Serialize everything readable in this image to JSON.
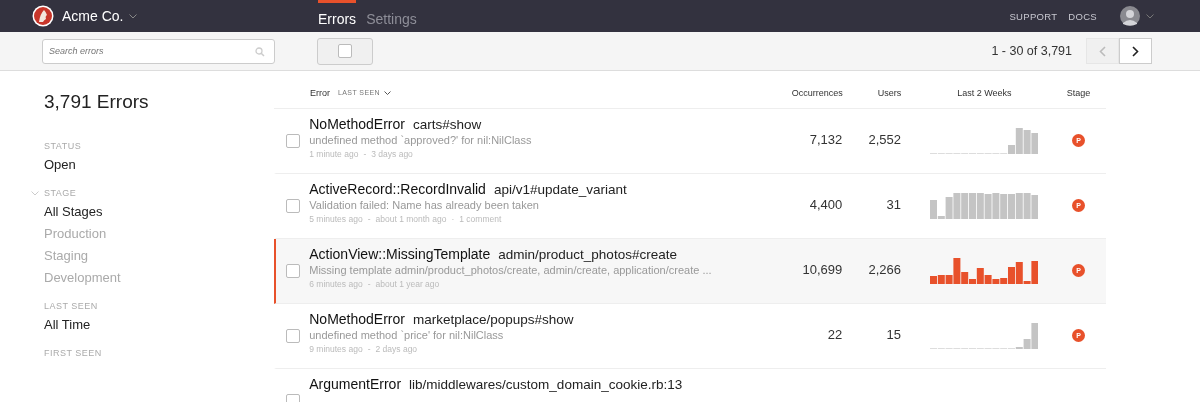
{
  "header": {
    "brand": "Acme Co.",
    "nav": [
      {
        "label": "Errors",
        "selected": true
      },
      {
        "label": "Settings",
        "selected": false
      }
    ],
    "links": [
      "SUPPORT",
      "DOCS"
    ]
  },
  "toolbar": {
    "search": {
      "placeholder": "Search errors"
    },
    "select_all": {
      "checked": false
    },
    "pagination": {
      "range": "1 - 30 of 3,791",
      "prev_disabled": true,
      "next_disabled": false
    }
  },
  "sidebar": {
    "title": "3,791 Errors",
    "sections": [
      {
        "label": "STATUS",
        "collapsible": false,
        "items": [
          {
            "label": "Open",
            "selected": true
          }
        ]
      },
      {
        "label": "STAGE",
        "collapsible": true,
        "items": [
          {
            "label": "All Stages",
            "selected": true
          },
          {
            "label": "Production",
            "selected": false
          },
          {
            "label": "Staging",
            "selected": false
          },
          {
            "label": "Development",
            "selected": false
          }
        ]
      },
      {
        "label": "LAST SEEN",
        "collapsible": false,
        "items": [
          {
            "label": "All Time",
            "selected": true
          }
        ]
      },
      {
        "label": "FIRST SEEN",
        "collapsible": false
      }
    ]
  },
  "table": {
    "columns": {
      "error": "Error",
      "sort": "LAST SEEN",
      "occurrences": "Occurrences",
      "users": "Users",
      "trend": "Last 2 Weeks",
      "stage": "Stage"
    },
    "rows": [
      {
        "checked": false,
        "highlighted": false,
        "error": "NoMethodError",
        "location": "carts#show",
        "message": "undefined method `approved?' for nil:NilClass",
        "meta": [
          "1 minute ago",
          "-",
          "3 days ago"
        ],
        "occurrences": "7,132",
        "users": "2,552",
        "stage": "P"
      },
      {
        "checked": false,
        "highlighted": false,
        "error": "ActiveRecord::RecordInvalid",
        "location": "api/v1#update_variant",
        "message": "Validation failed: Name has already been taken",
        "meta": [
          "5 minutes ago",
          "-",
          "about 1 month ago",
          "·",
          "1 comment"
        ],
        "occurrences": "4,400",
        "users": "31",
        "stage": "P"
      },
      {
        "checked": false,
        "highlighted": true,
        "error": "ActionView::MissingTemplate",
        "location": "admin/product_photos#create",
        "message": "Missing template admin/product_photos/create, admin/create, application/create ...",
        "meta": [
          "6 minutes ago",
          "-",
          "about 1 year ago"
        ],
        "occurrences": "10,699",
        "users": "2,266",
        "stage": "P"
      },
      {
        "checked": false,
        "highlighted": false,
        "error": "NoMethodError",
        "location": "marketplace/popups#show",
        "message": "undefined method `price' for nil:NilClass",
        "meta": [
          "9 minutes ago",
          "-",
          "2 days ago"
        ],
        "occurrences": "22",
        "users": "15",
        "stage": "P"
      },
      {
        "checked": false,
        "highlighted": false,
        "error": "ArgumentError",
        "location": "lib/middlewares/custom_domain_cookie.rb:13"
      }
    ]
  }
}
